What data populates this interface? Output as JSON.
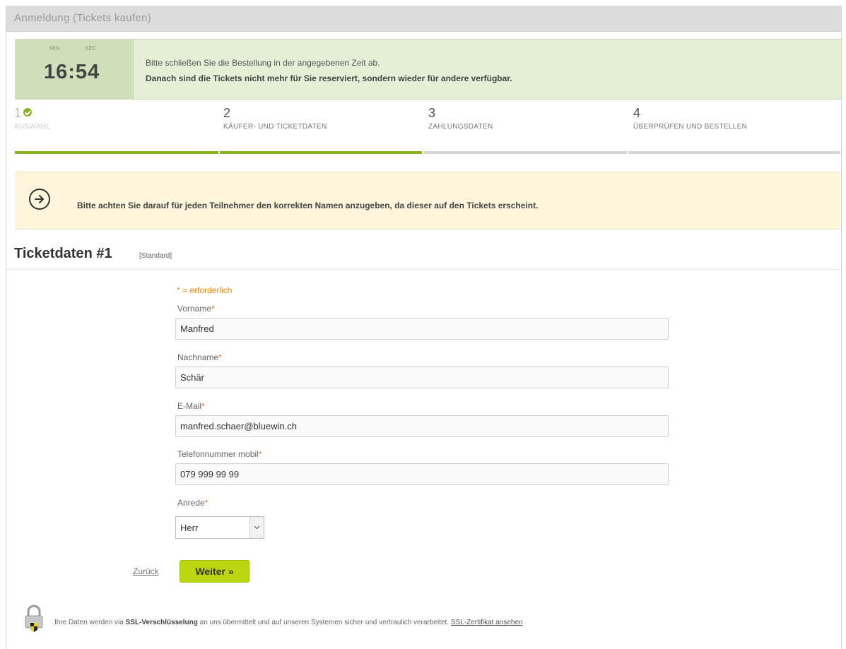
{
  "window": {
    "title": "Anmeldung (Tickets kaufen)"
  },
  "timer": {
    "min_label": "MIN",
    "sec_label": "SEC",
    "time": "16:54",
    "line1": "Bitte schließen Sie die Bestellung in der angegebenen Zeit ab.",
    "line2": "Danach sind die Tickets nicht mehr für Sie reserviert, sondern wieder für andere verfügbar."
  },
  "steps": [
    {
      "number": "1",
      "label": "AUSWAHL",
      "state": "done"
    },
    {
      "number": "2",
      "label": "KÄUFER- UND TICKETDATEN",
      "state": "active"
    },
    {
      "number": "3",
      "label": "ZAHLUNGSDATEN",
      "state": "upcoming"
    },
    {
      "number": "4",
      "label": "ÜBERPRÜFEN UND BESTELLEN",
      "state": "upcoming"
    }
  ],
  "notice": {
    "icon": "arrow-right-circle-icon",
    "text": "Bitte achten Sie darauf für jeden Teilnehmer den korrekten Namen anzugeben, da dieser auf den Tickets erscheint."
  },
  "section": {
    "title": "Ticketdaten #1",
    "tag": "[Standard]"
  },
  "form": {
    "required_note": "* = erforderlich",
    "required_marker": "*",
    "first_name": {
      "label": "Vorname",
      "value": "Manfred"
    },
    "last_name": {
      "label": "Nachname",
      "value": "Schär"
    },
    "email": {
      "label": "E-Mail",
      "value": "manfred.schaer@bluewin.ch"
    },
    "phone": {
      "label": "Telefonnummer mobil",
      "value": "079 999 99 99"
    },
    "salutation": {
      "label": "Anrede",
      "value": "Herr"
    }
  },
  "actions": {
    "back": "Zurück",
    "next": "Weiter »"
  },
  "ssl": {
    "text_before": "Ihre Daten werden via ",
    "bold": "SSL-Verschlüsselung",
    "text_after": " an uns übermittelt und auf unseren Systemen sicher und vertraulich verarbeitet. ",
    "link": "SSL-Zertifikat ansehen"
  },
  "colors": {
    "accent_green": "#8bb020",
    "button_green": "#bcd50f",
    "timer_bg": "#e4efd6",
    "notice_bg": "#fdf6dd",
    "required_orange": "#f0890a"
  }
}
